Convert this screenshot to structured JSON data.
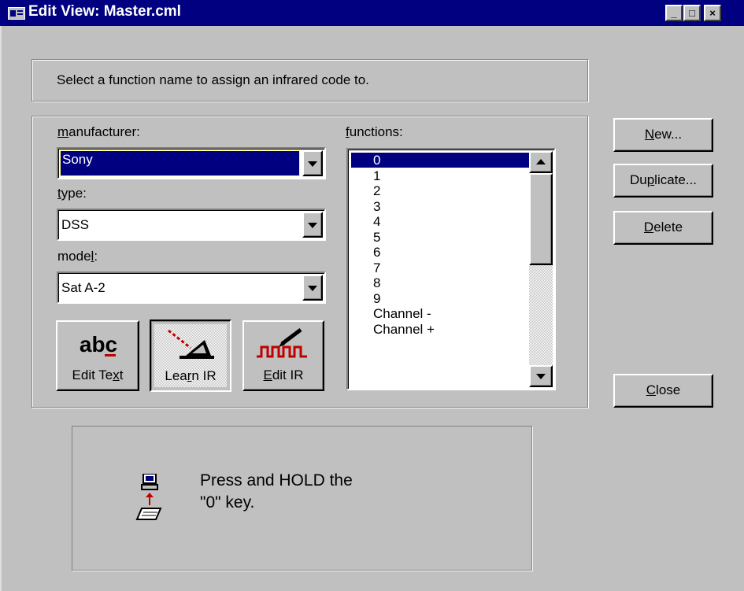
{
  "window": {
    "title": "Edit View: Master.cml",
    "icon": "app-window-icon",
    "controls": {
      "minimize": "_",
      "maximize": "□",
      "close": "×"
    }
  },
  "instruction": "Select a function name to assign an infrared code to.",
  "manufacturer": {
    "label": "manufacturer:",
    "value": "Sony"
  },
  "type": {
    "label": "type:",
    "value": "DSS"
  },
  "model": {
    "label": "model:",
    "value": "Sat A-2"
  },
  "functions": {
    "label": "functions:",
    "items": [
      "0",
      "1",
      "2",
      "3",
      "4",
      "5",
      "6",
      "7",
      "8",
      "9",
      "Channel -",
      "Channel +"
    ],
    "selected_index": 0
  },
  "tools": [
    {
      "label": "Edit Text",
      "icon": "abc-text-icon",
      "pressed": false
    },
    {
      "label": "Learn IR",
      "icon": "infrared-beam-icon",
      "pressed": true
    },
    {
      "label": "Edit IR",
      "icon": "ir-waveform-icon",
      "pressed": false
    }
  ],
  "buttons": {
    "new": "New...",
    "duplicate": "Duplicate...",
    "delete": "Delete",
    "close": "Close"
  },
  "status": {
    "line1": "Press and HOLD the",
    "line2": "\"0\" key.",
    "icon": "computer-remote-transfer-icon"
  },
  "colors": {
    "titlebar": "#000080",
    "face": "#c0c0c0",
    "selection": "#000080",
    "ir_red": "#c00000"
  }
}
